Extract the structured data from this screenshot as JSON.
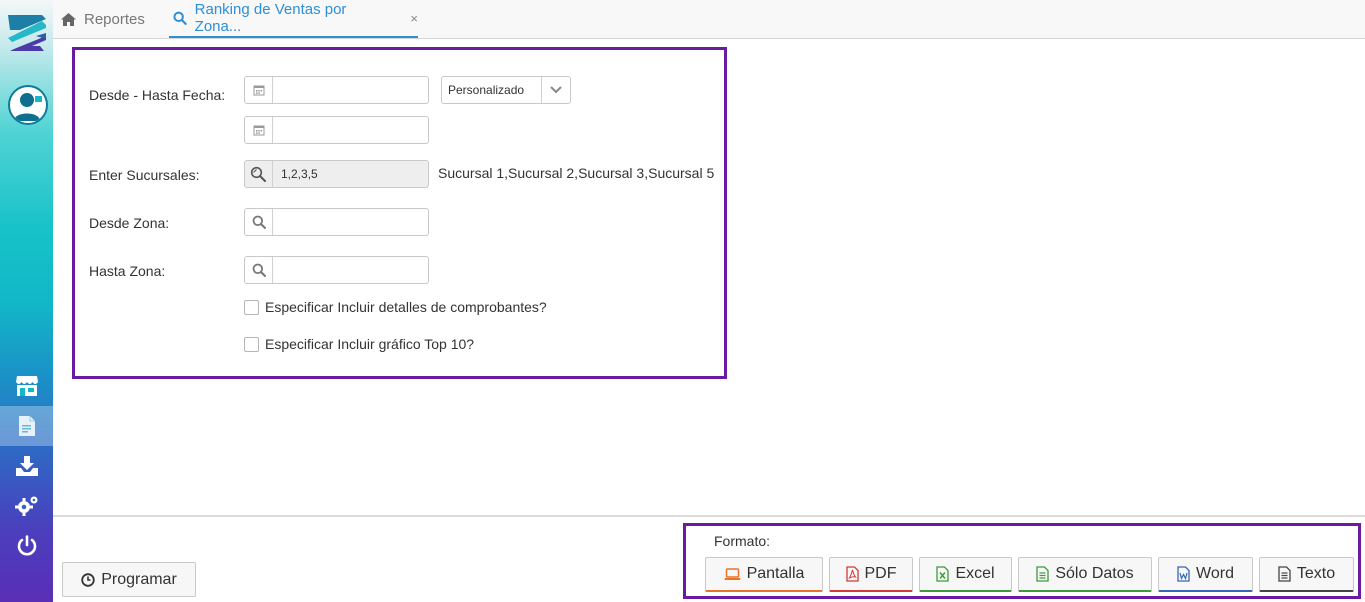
{
  "tabs": {
    "home_label": "Reportes",
    "active_label": "Ranking de Ventas por Zona...",
    "close_glyph": "×"
  },
  "form": {
    "fecha_label": "Desde - Hasta Fecha:",
    "fecha_desde_value": "",
    "fecha_hasta_value": "",
    "periodo_select": "Personalizado",
    "sucursales_label": "Enter Sucursales:",
    "sucursales_value": "1,2,3,5",
    "sucursales_desc": "Sucursal 1,Sucursal 2,Sucursal 3,Sucursal 5",
    "desde_zona_label": "Desde Zona:",
    "desde_zona_value": "",
    "hasta_zona_label": "Hasta Zona:",
    "hasta_zona_value": "",
    "chk_detalles_label": "Especificar Incluir detalles de comprobantes?",
    "chk_detalles_checked": false,
    "chk_grafico_label": "Especificar Incluir gráfico Top 10?",
    "chk_grafico_checked": false
  },
  "footer": {
    "programar_label": "Programar",
    "formato_label": "Formato:",
    "buttons": [
      {
        "label": "Pantalla",
        "icon": "laptop-icon",
        "accent": "#e8742a"
      },
      {
        "label": "PDF",
        "icon": "pdf-file-icon",
        "accent": "#d23a3a"
      },
      {
        "label": "Excel",
        "icon": "excel-file-icon",
        "accent": "#3c9a3c"
      },
      {
        "label": "Sólo Datos",
        "icon": "data-file-icon",
        "accent": "#3c9a3c"
      },
      {
        "label": "Word",
        "icon": "word-file-icon",
        "accent": "#3566b8"
      },
      {
        "label": "Texto",
        "icon": "text-file-icon",
        "accent": "#444444"
      }
    ]
  },
  "sidebar": {
    "items": [
      "store-icon",
      "report-icon",
      "download-icon",
      "settings-icon",
      "power-icon"
    ],
    "active": "report-icon"
  },
  "colors": {
    "accent": "#2d8fd6",
    "highlight_border": "#6b1aa2"
  }
}
